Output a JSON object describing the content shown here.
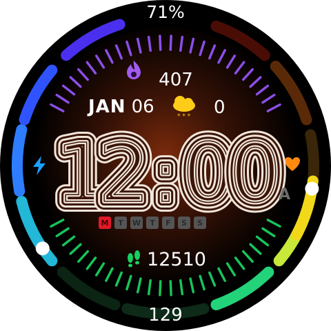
{
  "battery": {
    "percent_label": "71%"
  },
  "calories": {
    "value": "407"
  },
  "date": {
    "month": "JAN",
    "day": "06"
  },
  "weather": {
    "value": "0"
  },
  "time": {
    "display": "12:00",
    "ampm": "A"
  },
  "weekdays": [
    {
      "label": "M",
      "active": true
    },
    {
      "label": "T",
      "active": false
    },
    {
      "label": "W",
      "active": false
    },
    {
      "label": "T",
      "active": false
    },
    {
      "label": "F",
      "active": false
    },
    {
      "label": "S",
      "active": false
    },
    {
      "label": "S",
      "active": false
    }
  ],
  "steps": {
    "value": "12510"
  },
  "bottom": {
    "value": "129"
  },
  "gauges": {
    "left_level": 0.15,
    "right_level": 0.45
  },
  "colors": {
    "face_bg": "#000000",
    "glow": "#7a2a0c",
    "calories_ticks": "#8a4fe6",
    "steps_ticks": "#18c45a",
    "heart": "#ff8a10",
    "bolt": "#1aa0ff",
    "weather": "#ffd21a"
  },
  "icons": {
    "calories": "flame-icon",
    "weather": "cloud-snow-icon",
    "steps": "footprints-icon",
    "left": "bolt-icon",
    "right": "heart-icon"
  }
}
